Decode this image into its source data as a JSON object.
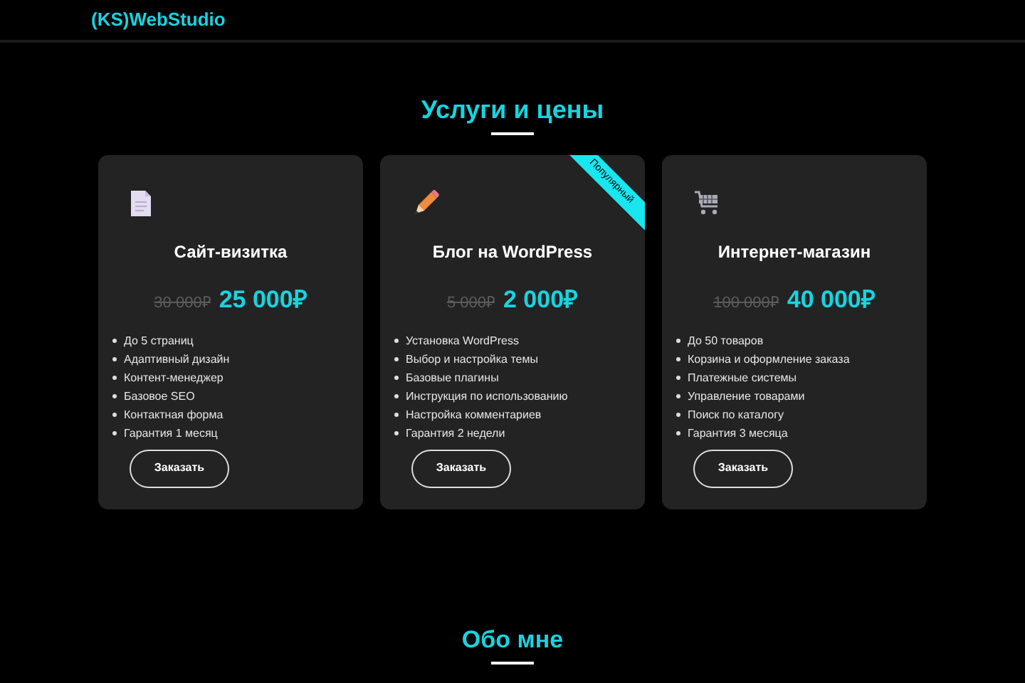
{
  "header": {
    "logo": "(KS)WebStudio"
  },
  "services": {
    "title": "Услуги и цены",
    "cards": [
      {
        "kind": "document",
        "title": "Сайт-визитка",
        "old_price": "30 000₽",
        "price": "25 000₽",
        "features": [
          "До 5 страниц",
          "Адаптивный дизайн",
          "Контент-менеджер",
          "Базовое SEO",
          "Контактная форма",
          "Гарантия 1 месяц"
        ],
        "button": "Заказать"
      },
      {
        "kind": "pencil",
        "ribbon": "Популярный",
        "title": "Блог на WordPress",
        "old_price": "5 000₽",
        "price": "2 000₽",
        "features": [
          "Установка WordPress",
          "Выбор и настройка темы",
          "Базовые плагины",
          "Инструкция по использованию",
          "Настройка комментариев",
          "Гарантия 2 недели"
        ],
        "button": "Заказать"
      },
      {
        "kind": "cart",
        "title": "Интернет-магазин",
        "old_price": "100 000₽",
        "price": "40 000₽",
        "features": [
          "До 50 товаров",
          "Корзина и оформление заказа",
          "Платежные системы",
          "Управление товарами",
          "Поиск по каталогу",
          "Гарантия 3 месяца"
        ],
        "button": "Заказать"
      }
    ]
  },
  "about": {
    "title": "Обо мне"
  }
}
